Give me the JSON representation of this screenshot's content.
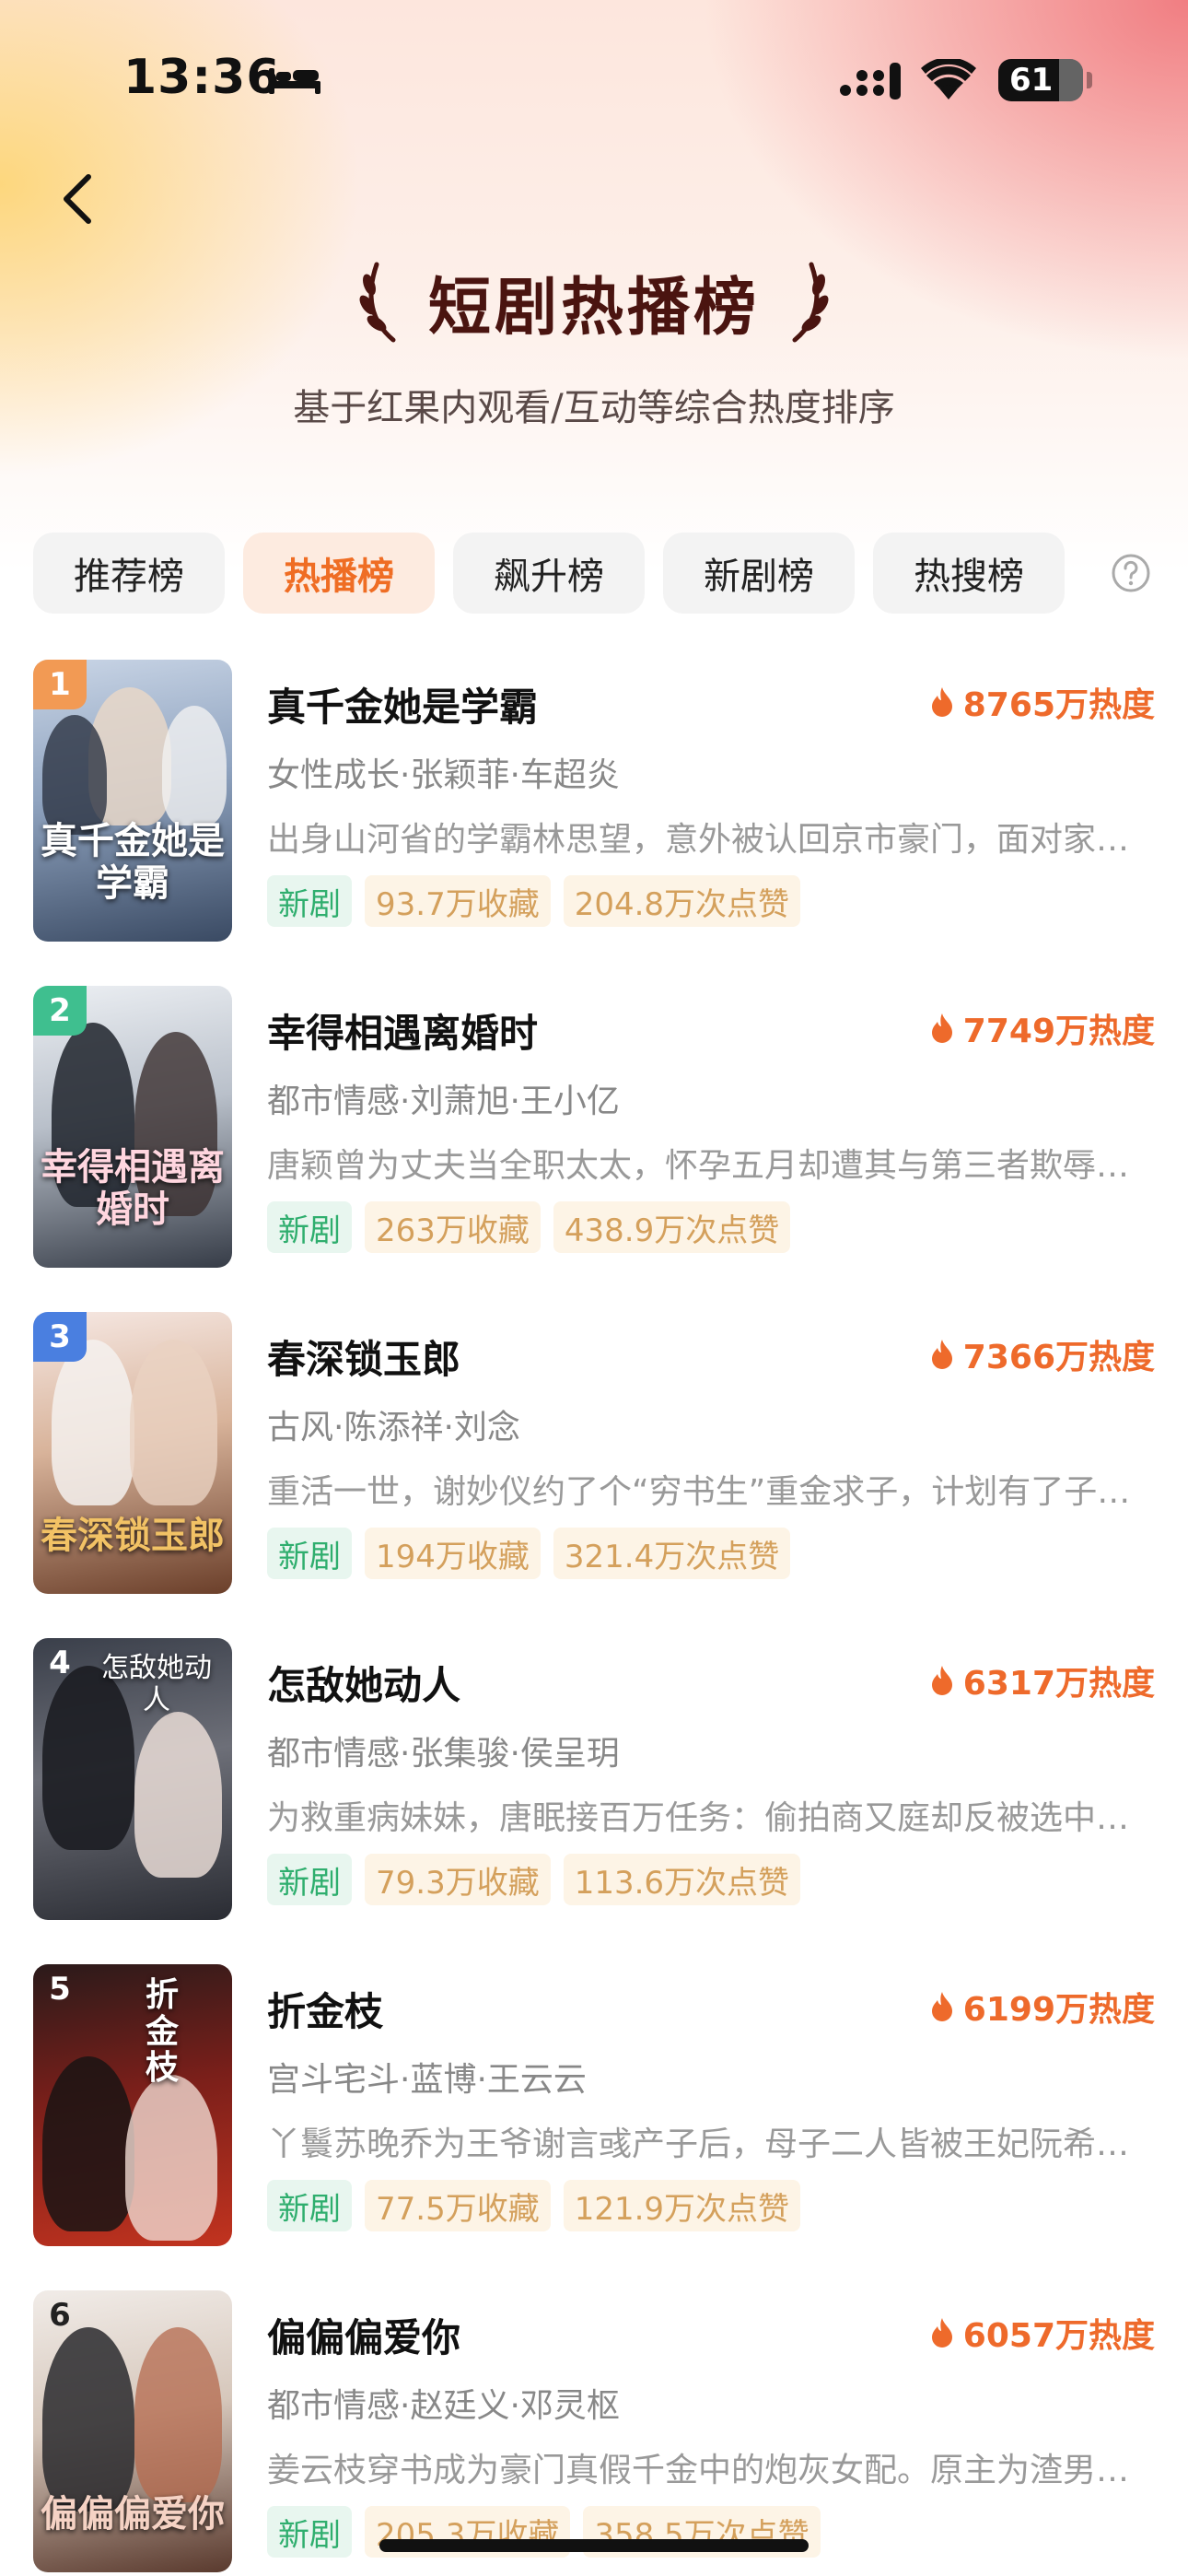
{
  "status_bar": {
    "time": "13:36",
    "battery": "61"
  },
  "header": {
    "title": "短剧热播榜",
    "subtitle": "基于红果内观看/互动等综合热度排序"
  },
  "tabs": [
    {
      "label": "推荐榜",
      "active": false
    },
    {
      "label": "热播榜",
      "active": true
    },
    {
      "label": "飙升榜",
      "active": false
    },
    {
      "label": "新剧榜",
      "active": false
    },
    {
      "label": "热搜榜",
      "active": false
    }
  ],
  "colors": {
    "accent": "#ef6d24",
    "rank_1": "#f29a54",
    "rank_2": "#3fbf8f",
    "rank_3": "#4a7fe0",
    "title_text": "#4a1410",
    "new_badge": "#2fae6e",
    "stat_badge": "#d4a05c"
  },
  "items": [
    {
      "rank": "1",
      "title": "真千金她是学霸",
      "heat": "8765万热度",
      "tags": "女性成长·张颖菲·车超炎",
      "desc": "出身山河省的学霸林思望，意外被认回京市豪门，面对家…",
      "badge_new": "新剧",
      "favorites": "93.7万收藏",
      "likes": "204.8万次点赞",
      "cover_title": "真千金她是学霸"
    },
    {
      "rank": "2",
      "title": "幸得相遇离婚时",
      "heat": "7749万热度",
      "tags": "都市情感·刘萧旭·王小亿",
      "desc": "唐颖曾为丈夫当全职太太，怀孕五月却遭其与第三者欺辱…",
      "badge_new": "新剧",
      "favorites": "263万收藏",
      "likes": "438.9万次点赞",
      "cover_title": "幸得相遇离婚时"
    },
    {
      "rank": "3",
      "title": "春深锁玉郎",
      "heat": "7366万热度",
      "tags": "古风·陈添祥·刘念",
      "desc": "重活一世，谢妙仪约了个“穷书生”重金求子，计划有了子…",
      "badge_new": "新剧",
      "favorites": "194万收藏",
      "likes": "321.4万次点赞",
      "cover_title": "春深锁玉郎"
    },
    {
      "rank": "4",
      "title": "怎敌她动人",
      "heat": "6317万热度",
      "tags": "都市情感·张集骏·侯呈玥",
      "desc": "为救重病妹妹，唐眠接百万任务：偷拍商又庭却反被选中…",
      "badge_new": "新剧",
      "favorites": "79.3万收藏",
      "likes": "113.6万次点赞",
      "cover_title": "怎敌她动人"
    },
    {
      "rank": "5",
      "title": "折金枝",
      "heat": "6199万热度",
      "tags": "宫斗宅斗·蓝博·王云云",
      "desc": "丫鬟苏晚乔为王爷谢言彧产子后，母子二人皆被王妃阮希…",
      "badge_new": "新剧",
      "favorites": "77.5万收藏",
      "likes": "121.9万次点赞",
      "cover_title": "折金枝"
    },
    {
      "rank": "6",
      "title": "偏偏偏爱你",
      "heat": "6057万热度",
      "tags": "都市情感·赵廷义·邓灵枢",
      "desc": "姜云枝穿书成为豪门真假千金中的炮灰女配。原主为渣男…",
      "badge_new": "新剧",
      "favorites": "205.3万收藏",
      "likes": "358.5万次点赞",
      "cover_title": "偏偏偏爱你"
    }
  ]
}
